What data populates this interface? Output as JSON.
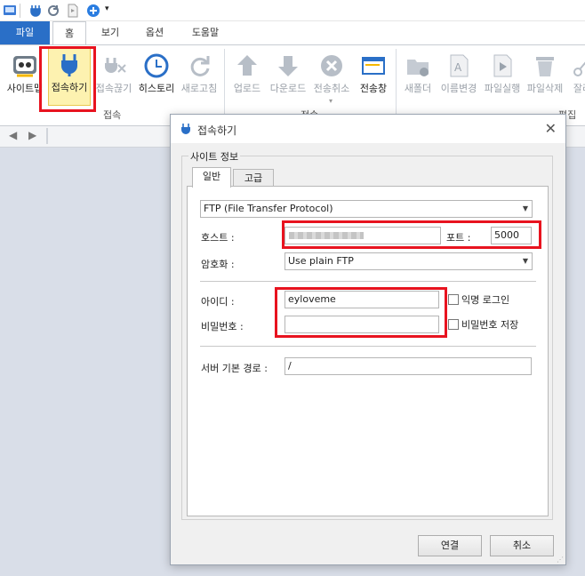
{
  "quick_access": {
    "icons": [
      "app-icon",
      "connect-icon",
      "refresh-icon",
      "file-icon",
      "add-icon",
      "dropdown-icon"
    ]
  },
  "ribbon_tabs": [
    "파일",
    "홈",
    "보기",
    "옵션",
    "도움말"
  ],
  "ribbon": {
    "connect_group": {
      "label": "접속",
      "buttons": [
        "사이트맵",
        "접속하기",
        "접속끊기",
        "히스토리",
        "새로고침"
      ]
    },
    "transfer_group": {
      "label": "전송",
      "buttons": [
        "업로드",
        "다운로드",
        "전송취소",
        "전송창"
      ]
    },
    "edit_group": {
      "label": "편집",
      "buttons": [
        "새폴더",
        "이름변경",
        "파일실행",
        "파일삭제",
        "잘라"
      ]
    }
  },
  "dialog": {
    "title": "접속하기",
    "section_label": "사이트 정보",
    "tabs": [
      "일반",
      "고급"
    ],
    "protocol": "FTP (File Transfer Protocol)",
    "host_label": "호스트 :",
    "port_label": "포트 :",
    "port_value": "5000",
    "encryption_label": "암호화 :",
    "encryption_value": "Use plain FTP",
    "id_label": "아이디 :",
    "id_value": "eyloveme",
    "anonymous_label": "익명 로그인",
    "password_label": "비밀번호 :",
    "password_value": "",
    "save_password_label": "비밀번호 저장",
    "server_path_label": "서버 기본 경로 :",
    "server_path_value": "/",
    "connect_button": "연결",
    "cancel_button": "취소"
  },
  "colors": {
    "accent": "#2a6fc7",
    "highlight_box": "#e8131f",
    "selected_button": "#fdf2b0"
  }
}
